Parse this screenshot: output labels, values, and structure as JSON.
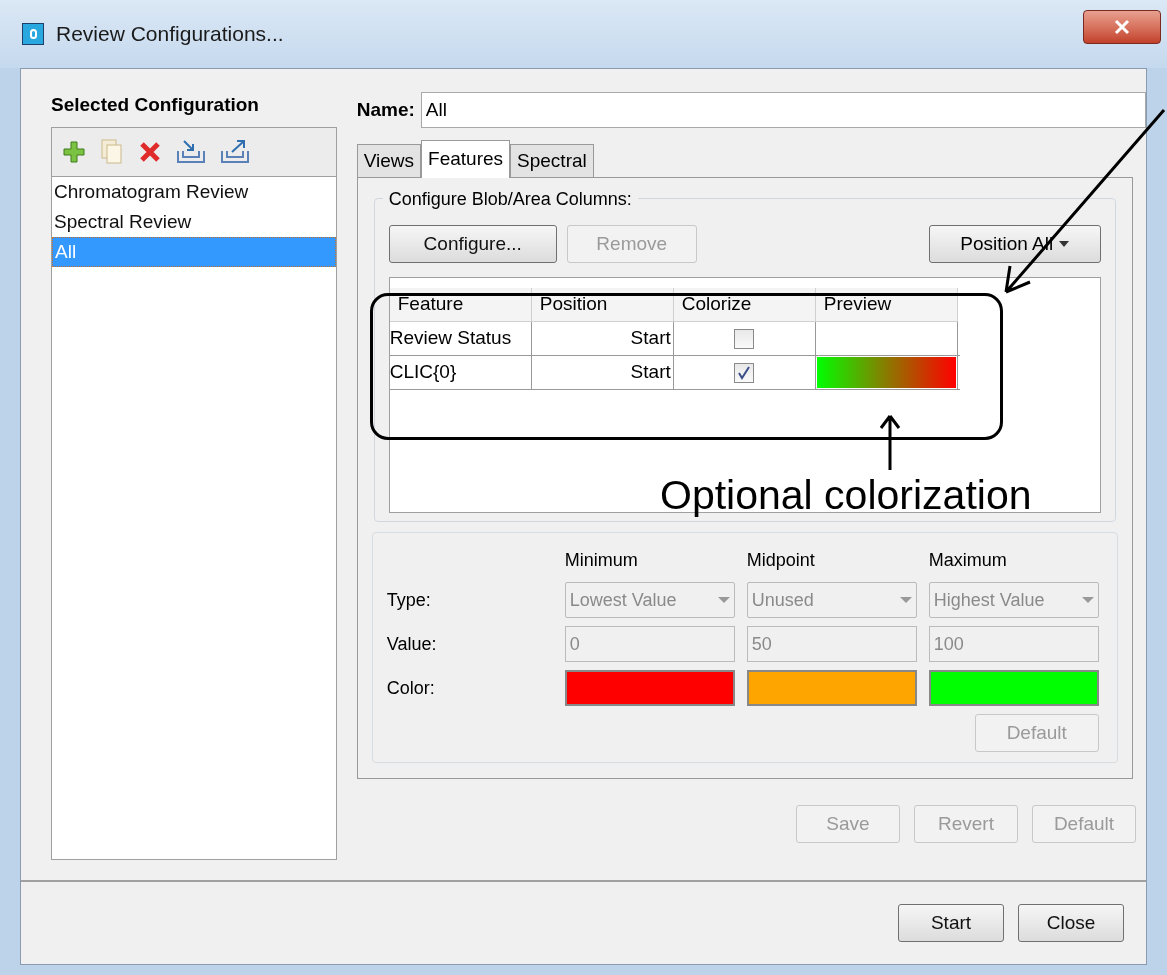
{
  "window": {
    "title": "Review Configurations..."
  },
  "sidebar": {
    "heading": "Selected Configuration",
    "items": [
      {
        "label": "Chromatogram Review",
        "selected": false
      },
      {
        "label": "Spectral Review",
        "selected": false
      },
      {
        "label": "All",
        "selected": true
      }
    ]
  },
  "name_field": {
    "label": "Name:",
    "value": "All"
  },
  "tabs": [
    {
      "label": "Views",
      "selected": false
    },
    {
      "label": "Features",
      "selected": true
    },
    {
      "label": "Spectral",
      "selected": false
    }
  ],
  "columns_group": {
    "title": "Configure Blob/Area Columns:",
    "buttons": [
      {
        "label": "Configure...",
        "disabled": false
      },
      {
        "label": "Remove",
        "disabled": true
      }
    ],
    "position_all": "Position All"
  },
  "table": {
    "columns": [
      "Feature",
      "Position",
      "Colorize",
      "Preview"
    ],
    "rows": [
      {
        "feature": "Review Status",
        "position": "Start",
        "colorize": false
      },
      {
        "feature": "CLIC{0}",
        "position": "Start",
        "colorize": true
      }
    ]
  },
  "color_scale": {
    "disabled": true,
    "row_labels": [
      "Type:",
      "Value:",
      "Color:"
    ],
    "points": [
      {
        "heading": "Minimum",
        "type": "Lowest Value",
        "value": "0",
        "color": "#ff0000"
      },
      {
        "heading": "Midpoint",
        "type": "Unused",
        "value": "50",
        "color": "#ffa500"
      },
      {
        "heading": "Maximum",
        "type": "Highest Value",
        "value": "100",
        "color": "#00ff00"
      }
    ],
    "default_button": {
      "label": "Default",
      "disabled": true
    }
  },
  "edit_buttons": [
    {
      "label": "Save",
      "disabled": true
    },
    {
      "label": "Revert",
      "disabled": true
    },
    {
      "label": "Default",
      "disabled": true
    }
  ],
  "footer_buttons": [
    {
      "label": "Start",
      "disabled": false
    },
    {
      "label": "Close",
      "disabled": false
    }
  ],
  "annotation": {
    "text": "Optional colorization"
  }
}
